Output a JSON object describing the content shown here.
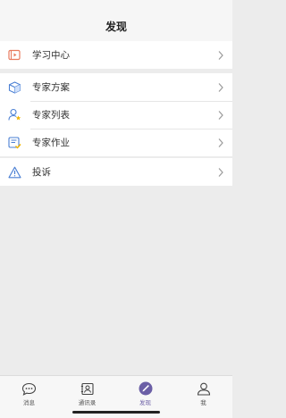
{
  "header": {
    "title": "发现"
  },
  "groups": [
    {
      "items": [
        {
          "label": "学习中心",
          "icon": "video-icon"
        }
      ]
    },
    {
      "items": [
        {
          "label": "专家方案",
          "icon": "box-icon"
        },
        {
          "label": "专家列表",
          "icon": "user-star-icon"
        },
        {
          "label": "专家作业",
          "icon": "document-check-icon"
        }
      ]
    },
    {
      "items": [
        {
          "label": "投诉",
          "icon": "warning-icon"
        }
      ]
    }
  ],
  "tabs": [
    {
      "label": "消息",
      "icon": "chat-icon"
    },
    {
      "label": "通讯录",
      "icon": "contacts-icon"
    },
    {
      "label": "发现",
      "icon": "compass-icon",
      "active": true
    },
    {
      "label": "我",
      "icon": "person-icon"
    }
  ],
  "colors": {
    "accent": "#6b5fa6",
    "icon_orange": "#e87a5d",
    "icon_blue": "#4a7fd3",
    "icon_yellow": "#f0b400"
  }
}
